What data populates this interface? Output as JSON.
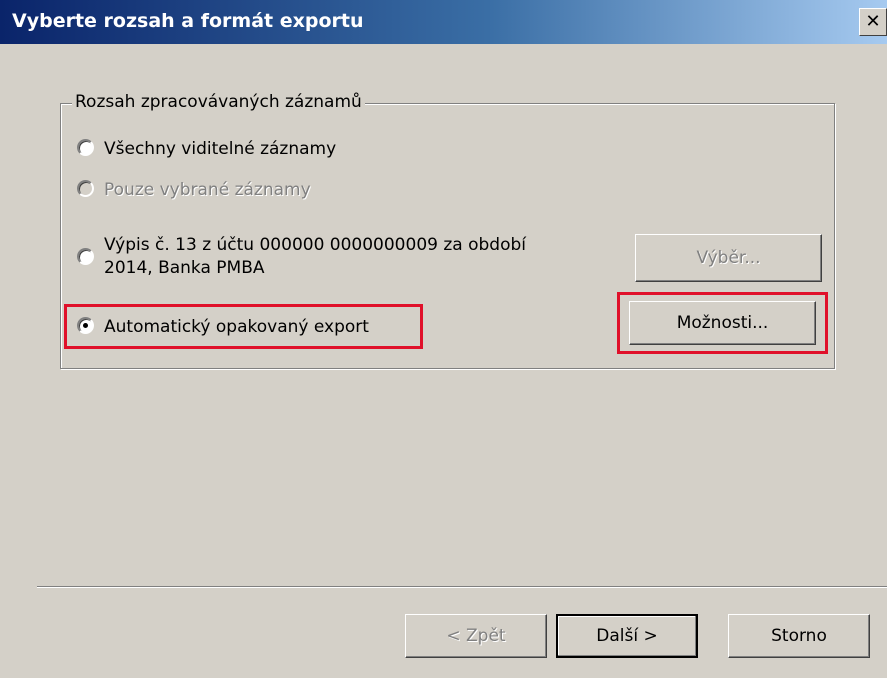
{
  "window": {
    "title": "Vyberte rozsah a formát exportu",
    "close_label": "✕"
  },
  "group": {
    "label": "Rozsah zpracovávaných záznamů",
    "options": [
      {
        "label": "Všechny viditelné záznamy",
        "checked": false,
        "enabled": true
      },
      {
        "label": "Pouze vybrané záznamy",
        "checked": false,
        "enabled": false
      },
      {
        "label_line1": "Výpis č. 13 z účtu 000000 0000000009 za období",
        "label_line2": "2014, Banka PMBA",
        "checked": false,
        "enabled": true
      },
      {
        "label": "Automatický opakovaný export",
        "checked": true,
        "enabled": true
      }
    ],
    "select_button": "Výběr...",
    "options_button": "Možnosti..."
  },
  "footer": {
    "back_button": "< Zpět",
    "next_button": "Další >",
    "cancel_button": "Storno"
  },
  "colors": {
    "highlight": "#e0102a",
    "titlebar_start": "#0a246a",
    "face": "#d4d0c8"
  }
}
